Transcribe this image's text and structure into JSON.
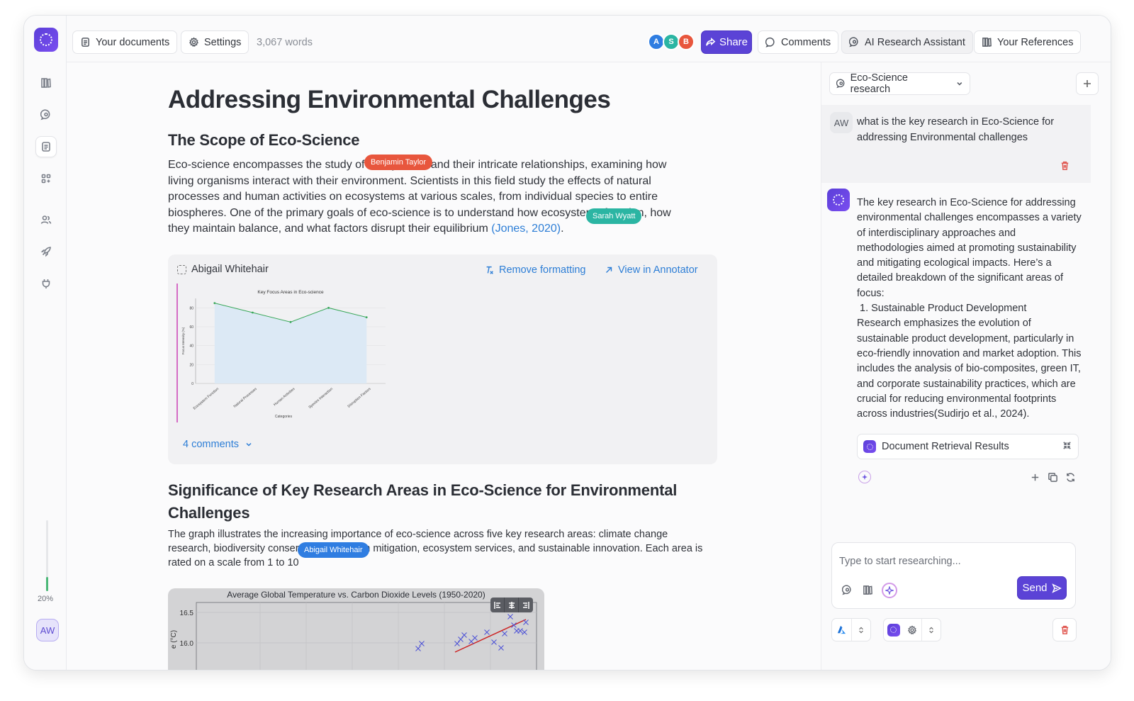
{
  "topbar": {
    "your_documents": "Your documents",
    "settings": "Settings",
    "word_count": "3,067 words",
    "collaborators": [
      {
        "initial": "A",
        "color": "#2f7de1"
      },
      {
        "initial": "S",
        "color": "#2bb5a3"
      },
      {
        "initial": "B",
        "color": "#e8563d"
      }
    ],
    "share": "Share",
    "comments": "Comments",
    "ai_assistant": "AI Research Assistant",
    "references": "Your References"
  },
  "sidebar": {
    "progress_label": "20%",
    "progress_value": 0.2,
    "user_initials": "AW"
  },
  "document": {
    "title": "Addressing Environmental Challenges",
    "section1_heading": "The Scope of Eco-Science",
    "section1_lines": [
      "Eco-science encompasses the study of ecosystems and their intricate relationships, examining how",
      "living organisms interact with their environment. Scientists in this field study the effects of natural",
      "processes and human activities on ecosystems at various scales, from individual species to entire",
      "biospheres. One of the primary goals of eco-science is to understand how ecosystems function, how"
    ],
    "section1_last_line": "they maintain balance, and what factors disrupt their equilibrium",
    "citation": "(Jones, 2020)",
    "cursor_tags": [
      {
        "name": "Benjamin Taylor",
        "color": "#e8563d"
      },
      {
        "name": "Sarah Wyatt",
        "color": "#2bb5a3"
      },
      {
        "name": "Abigail Whitehair",
        "color": "#2f7de1"
      }
    ],
    "card": {
      "author": "Abigail Whitehair",
      "remove_formatting": "Remove formatting",
      "view_annotator": "View in Annotator",
      "comments_count": "4 comments"
    },
    "section2_heading_line1": "Significance of Key Research Areas in Eco-Science for Environmental",
    "section2_heading_line2": "Challenges",
    "section2_lines": [
      "The graph illustrates the increasing importance of eco-science across five key research areas: climate change",
      "research, biodiversity conservation, pollution mitigation, ecosystem services, and sustainable innovation. Each area is",
      "rated on a scale from 1 to 10"
    ]
  },
  "chart_data": [
    {
      "type": "area",
      "title": "Key Focus Areas in Eco-science",
      "xlabel": "Categories",
      "ylabel": "Focus Intensity (%)",
      "categories": [
        "Ecosystem Function",
        "Natural Processes",
        "Human Activities",
        "Species Interaction",
        "Disruption Factors"
      ],
      "values": [
        85,
        75,
        65,
        80,
        70
      ],
      "ylim": [
        0,
        90
      ],
      "yticks": [
        0,
        20,
        40,
        60,
        80
      ],
      "line_color": "#3aa85a",
      "fill_color": "#dce9f5"
    },
    {
      "type": "scatter",
      "title": "Average Global Temperature vs. Carbon Dioxide Levels (1950-2020)",
      "ylabel_partial": "e (°C)",
      "yticks": [
        16.0,
        16.5
      ],
      "marker_color": "#4a4fd6",
      "trend_color": "#cc2222"
    }
  ],
  "panel": {
    "conversation": "Eco-Science research",
    "user_initials": "AW",
    "user_message": "what is the key research in Eco-Science for addressing Environmental challenges",
    "assistant_intro": "The key research in Eco-Science for addressing environmental challenges encompasses a variety of interdisciplinary approaches and methodologies aimed at promoting sustainability and mitigating ecological impacts. Here’s a detailed breakdown of the significant areas of focus:",
    "assistant_item": "1. Sustainable Product Development",
    "assistant_detail": "Research emphasizes the evolution of sustainable product development, particularly in eco-friendly innovation and market adoption. This includes the analysis of bio-composites, green IT, and corporate sustainability practices, which are crucial for reducing environmental footprints across industries(Sudirjo et al., 2024).",
    "retrieval": "Document Retrieval Results",
    "input_placeholder": "Type to start researching...",
    "send": "Send"
  }
}
